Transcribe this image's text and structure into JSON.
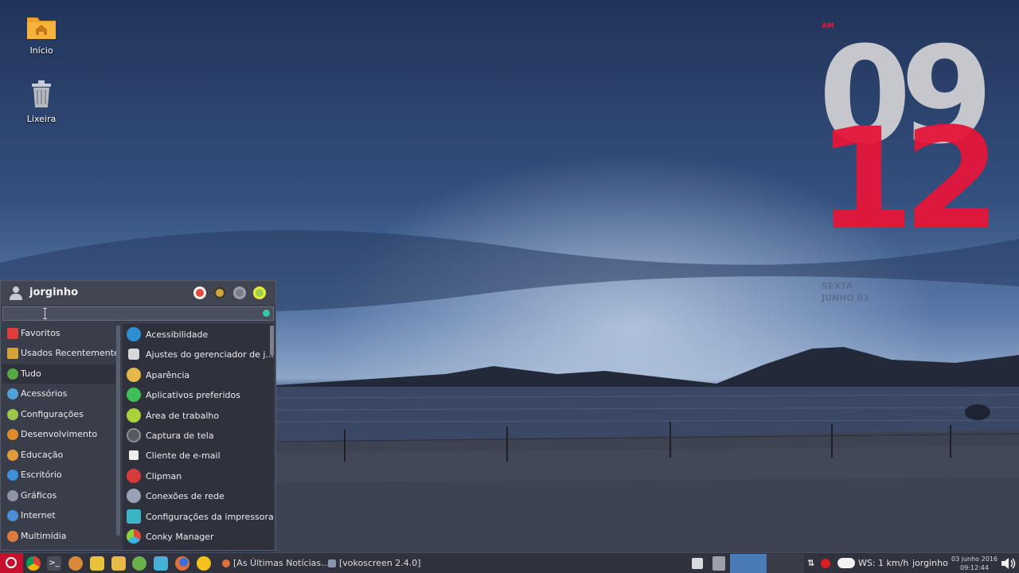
{
  "desktop": {
    "icons": [
      {
        "label": "Início",
        "icon": "home-folder-icon"
      },
      {
        "label": "Lixeira",
        "icon": "trash-icon"
      }
    ]
  },
  "conky": {
    "prefix": "AM",
    "hour": "09",
    "minute": "12",
    "weekday": "SEXTA",
    "month_day": "JUNHO 03",
    "hour_color": "#cfcfd2",
    "minute_color": "#e5163a"
  },
  "menu": {
    "username": "jorginho",
    "search": {
      "value": "",
      "placeholder": ""
    },
    "header_buttons": [
      {
        "icon": "lock-icon",
        "color": "#e24b3b"
      },
      {
        "icon": "shield-icon",
        "color": "#d3a63a"
      },
      {
        "icon": "logout-icon",
        "color": "#7a7f8c"
      },
      {
        "icon": "power-icon",
        "color": "#9bd44a"
      }
    ],
    "categories": [
      {
        "label": "Favoritos",
        "icon": "bookmark-icon",
        "color": "#e23b3b"
      },
      {
        "label": "Usados Recentemente",
        "icon": "recent-icon",
        "color": "#d7a13a"
      },
      {
        "label": "Tudo",
        "icon": "all-apps-icon",
        "color": "#56a843",
        "selected": true
      },
      {
        "label": "Acessórios",
        "icon": "accessories-icon",
        "color": "#4fa1d8"
      },
      {
        "label": "Configurações",
        "icon": "settings-icon",
        "color": "#9bc64a"
      },
      {
        "label": "Desenvolvimento",
        "icon": "development-icon",
        "color": "#e08a2a"
      },
      {
        "label": "Educação",
        "icon": "education-icon",
        "color": "#e09a3a"
      },
      {
        "label": "Escritório",
        "icon": "office-icon",
        "color": "#3c8fd8"
      },
      {
        "label": "Gráficos",
        "icon": "graphics-icon",
        "color": "#8e94a3"
      },
      {
        "label": "Internet",
        "icon": "internet-icon",
        "color": "#4a8fd6"
      },
      {
        "label": "Multimídia",
        "icon": "multimedia-icon",
        "color": "#e07a3a"
      }
    ],
    "apps": [
      {
        "label": "Acessibilidade",
        "icon": "accessibility-icon",
        "color": "#2e8fd0"
      },
      {
        "label": "Ajustes do gerenciador de j...",
        "icon": "window-manager-icon",
        "color": "#d8d8dc"
      },
      {
        "label": "Aparência",
        "icon": "appearance-icon",
        "color": "#e6b84a"
      },
      {
        "label": "Aplicativos preferidos",
        "icon": "preferred-apps-icon",
        "color": "#3fbf5a"
      },
      {
        "label": "Área de trabalho",
        "icon": "desktop-icon",
        "color": "#a8d13a"
      },
      {
        "label": "Captura de tela",
        "icon": "screenshot-icon",
        "color": "#56595f"
      },
      {
        "label": "Cliente de e-mail",
        "icon": "email-icon",
        "color": "#eeeeee"
      },
      {
        "label": "Clipman",
        "icon": "clipman-icon",
        "color": "#d63a3a"
      },
      {
        "label": "Conexões de rede",
        "icon": "network-icon",
        "color": "#9aa3b5"
      },
      {
        "label": "Configurações da impressora",
        "icon": "printer-icon",
        "color": "#3ab5c6"
      },
      {
        "label": "Conky Manager",
        "icon": "conky-icon",
        "color": "#e14a3a"
      }
    ]
  },
  "taskbar": {
    "launchers": [
      {
        "icon": "debian-menu-icon",
        "color": "#c8102e"
      },
      {
        "icon": "chrome-icon",
        "color": "#e8a23a"
      },
      {
        "icon": "terminal-icon",
        "color": "#4a4e58"
      },
      {
        "icon": "gimp-icon",
        "color": "#d88a3a"
      },
      {
        "icon": "notes-icon",
        "color": "#e8c33a"
      },
      {
        "icon": "file-manager-icon",
        "color": "#e7b84a"
      },
      {
        "icon": "software-center-icon",
        "color": "#6bb04a"
      },
      {
        "icon": "text-editor-icon",
        "color": "#48b0d8"
      },
      {
        "icon": "firefox-icon",
        "color": "#e0703a"
      },
      {
        "icon": "media-player-icon",
        "color": "#f2c21a"
      }
    ],
    "tasks": [
      {
        "label": "[As Últimas Notícias...",
        "icon": "browser-task-icon",
        "color": "#e0703a"
      },
      {
        "label": "[vokoscreen 2.4.0]",
        "icon": "vokoscreen-task-icon",
        "color": "#8a96b0"
      }
    ],
    "tray": {
      "weather": "WS: 1 km/h",
      "user": "jorginho",
      "date": "03 junho 2016",
      "time": "09:12:44"
    }
  }
}
